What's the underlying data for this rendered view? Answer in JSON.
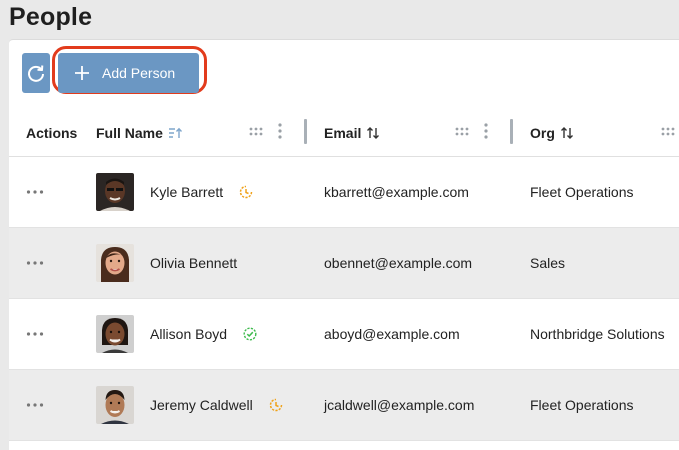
{
  "page": {
    "title": "People"
  },
  "toolbar": {
    "add_label": "Add Person"
  },
  "table": {
    "columns": {
      "actions": "Actions",
      "name": "Full Name",
      "email": "Email",
      "org": "Org"
    },
    "rows": [
      {
        "name": "Kyle Barrett",
        "email": "kbarrett@example.com",
        "org": "Fleet Operations",
        "status_icon": "pending-clock-icon"
      },
      {
        "name": "Olivia Bennett",
        "email": "obennet@example.com",
        "org": "Sales",
        "status_icon": ""
      },
      {
        "name": "Allison Boyd",
        "email": "aboyd@example.com",
        "org": "Northbridge Solutions",
        "status_icon": "verified-check-icon"
      },
      {
        "name": "Jeremy Caldwell",
        "email": "jcaldwell@example.com",
        "org": "Fleet Operations",
        "status_icon": "pending-clock-icon"
      }
    ]
  },
  "colors": {
    "button": "#6b97c3",
    "highlight": "#e23b1c",
    "pending": "#f0a21a",
    "verified": "#3dbb4c",
    "row_alt": "#ececec"
  }
}
